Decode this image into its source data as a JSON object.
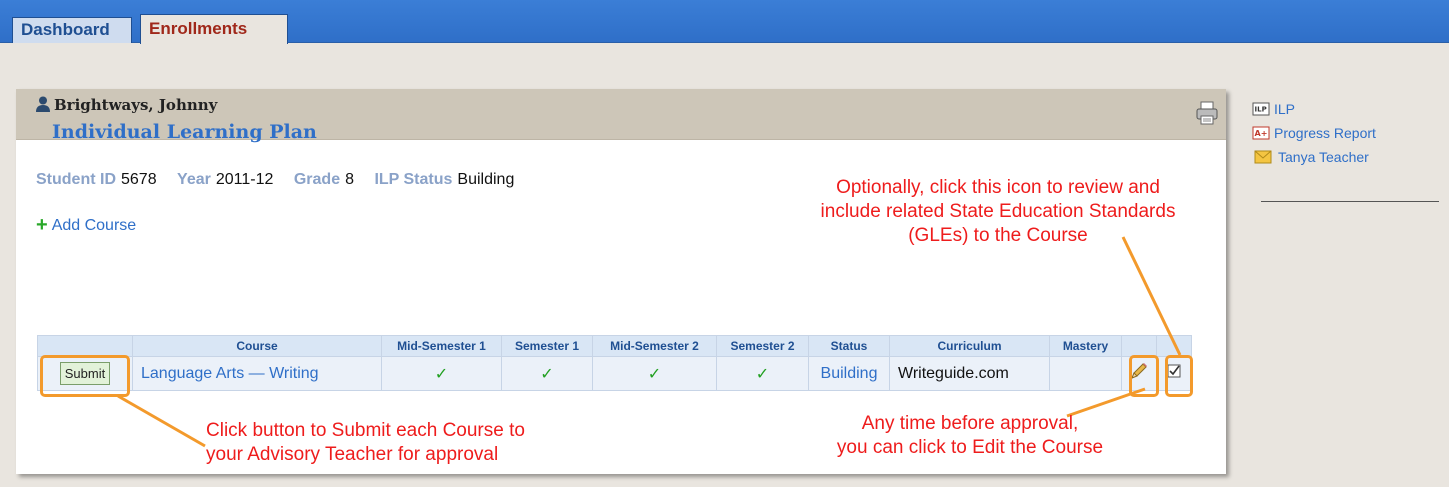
{
  "tabs": [
    {
      "label": "Dashboard"
    },
    {
      "label": "Enrollments"
    }
  ],
  "student": {
    "name": "Brightways, Johnny",
    "plan_title": "Individual Learning Plan",
    "info": {
      "student_id_label": "Student ID",
      "student_id": "5678",
      "year_label": "Year",
      "year": "2011-12",
      "grade_label": "Grade",
      "grade": "8",
      "ilp_status_label": "ILP Status",
      "ilp_status": "Building"
    }
  },
  "add_course_label": "Add Course",
  "table": {
    "headers": [
      "Course",
      "Mid-Semester 1",
      "Semester 1",
      "Mid-Semester 2",
      "Semester 2",
      "Status",
      "Curriculum",
      "Mastery"
    ],
    "rows": [
      {
        "submit_label": "Submit",
        "course": "Language Arts — Writing",
        "mid_semester_1": "✓",
        "semester_1": "✓",
        "mid_semester_2": "✓",
        "semester_2": "✓",
        "status": "Building",
        "curriculum": "Writeguide.com",
        "mastery": ""
      }
    ]
  },
  "annotations": {
    "submit_note_line1": "Click button to Submit each Course to",
    "submit_note_line2": "your Advisory Teacher for approval",
    "edit_note_line1": "Any time before approval,",
    "edit_note_line2": "you can click to Edit the Course",
    "optional_note_line1": "Optionally, click this icon to review and",
    "optional_note_line2": "include related State Education Standards",
    "optional_note_line3": "(GLEs) to the Course"
  },
  "sidebar": {
    "items": [
      {
        "label": "ILP",
        "icon": "ilp-document-icon"
      },
      {
        "label": "Progress Report",
        "icon": "report-card-icon"
      },
      {
        "label": "Tanya Teacher",
        "icon": "envelope-icon"
      }
    ]
  },
  "colors": {
    "tab_bar": "#2f6fc8",
    "link": "#2f6fc8",
    "annotation_red": "#ee1c1c",
    "callout_orange": "#f39a2c",
    "check_green": "#22a022"
  }
}
